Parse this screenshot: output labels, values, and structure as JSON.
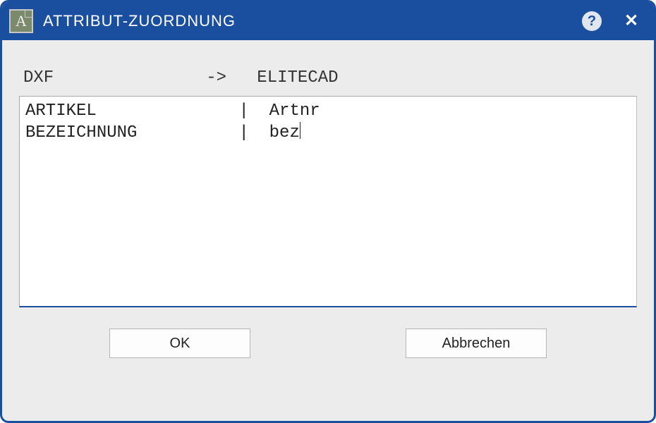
{
  "colors": {
    "accent": "#1a4fa0",
    "background": "#ececec"
  },
  "titlebar": {
    "title": "ATTRIBUT-ZUORDNUNG",
    "app_icon_letter": "A"
  },
  "header": {
    "left_label": "DXF",
    "arrow": "->",
    "right_label": "ELITECAD"
  },
  "mapping_lines": [
    {
      "dxf": "ARTIKEL",
      "elitecad": "Artnr"
    },
    {
      "dxf": "BEZEICHNUNG",
      "elitecad": "bez"
    }
  ],
  "buttons": {
    "ok": "OK",
    "cancel": "Abbrechen"
  }
}
